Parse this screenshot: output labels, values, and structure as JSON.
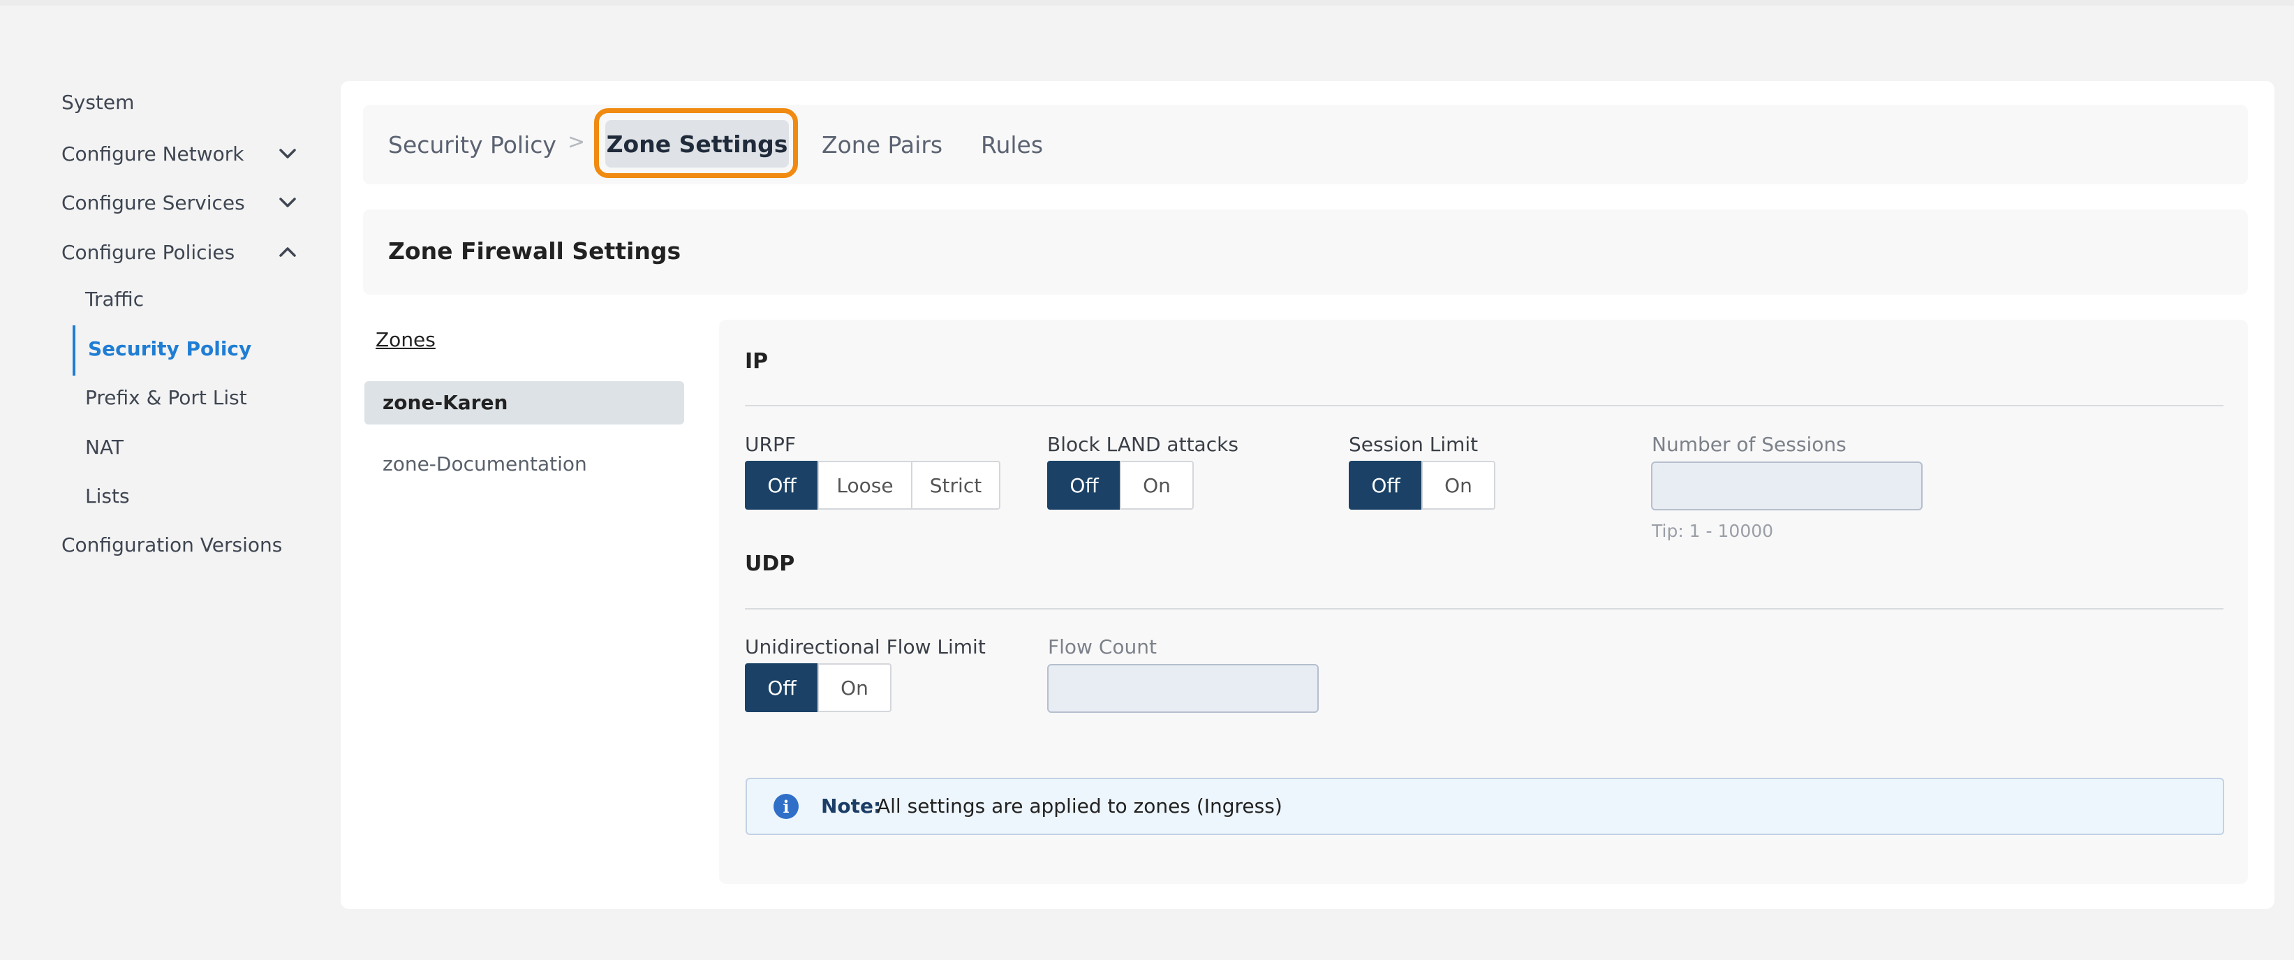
{
  "sidebar": {
    "items": [
      {
        "label": "System"
      },
      {
        "label": "Configure Network",
        "icon": "chevron-down-icon"
      },
      {
        "label": "Configure Services",
        "icon": "chevron-down-icon"
      },
      {
        "label": "Configure Policies",
        "icon": "chevron-up-icon"
      },
      {
        "label": "Configuration Versions"
      }
    ],
    "sub_items": [
      {
        "label": "Traffic"
      },
      {
        "label": "Security Policy",
        "active": true
      },
      {
        "label": "Prefix & Port List"
      },
      {
        "label": "NAT"
      },
      {
        "label": "Lists"
      }
    ]
  },
  "breadcrumb": {
    "parent": "Security Policy",
    "separator": ">",
    "tabs": [
      {
        "label": "Zone Settings",
        "active": true
      },
      {
        "label": "Zone Pairs"
      },
      {
        "label": "Rules"
      }
    ]
  },
  "section": {
    "title": "Zone Firewall Settings"
  },
  "zones": {
    "title": "Zones",
    "items": [
      {
        "label": "zone-Karen",
        "selected": true
      },
      {
        "label": "zone-Documentation"
      }
    ]
  },
  "ip": {
    "title": "IP",
    "urpf": {
      "label": "URPF",
      "options": [
        "Off",
        "Loose",
        "Strict"
      ],
      "selected": "Off"
    },
    "block_land": {
      "label": "Block LAND attacks",
      "options": [
        "Off",
        "On"
      ],
      "selected": "Off"
    },
    "session_limit": {
      "label": "Session Limit",
      "options": [
        "Off",
        "On"
      ],
      "selected": "Off"
    },
    "sessions": {
      "label": "Number of Sessions",
      "value": "",
      "tip": "Tip: 1 - 10000"
    }
  },
  "udp": {
    "title": "UDP",
    "flow_limit": {
      "label": "Unidirectional Flow Limit",
      "options": [
        "Off",
        "On"
      ],
      "selected": "Off"
    },
    "flow_count": {
      "label": "Flow Count",
      "value": ""
    }
  },
  "note": {
    "icon": "info-icon",
    "label": "Note:",
    "text": "All settings are applied to zones (Ingress)"
  },
  "colors": {
    "accent": "#1f7dd4",
    "selected_segment": "#1b4266",
    "highlight_outline": "#f08a10",
    "info_icon": "#2f6fc8"
  }
}
